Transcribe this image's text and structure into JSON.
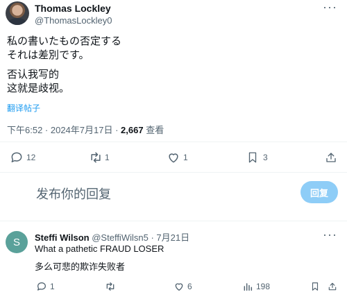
{
  "tweet": {
    "author_name": "Thomas Lockley",
    "author_handle": "@ThomasLockley0",
    "more_icon": "···",
    "text_jp_line1": "私の書いたもの否定する",
    "text_jp_line2": "それは差別です。",
    "text_cn_line1": "否认我写的",
    "text_cn_line2": "这就是歧视。",
    "translate_label": "翻译帖子",
    "timestamp": "下午6:52 · 2024年7月17日 · ",
    "views_count": "2,667",
    "views_label": " 查看",
    "actions": {
      "replies": "12",
      "reposts": "1",
      "likes": "1",
      "bookmarks": "3"
    }
  },
  "composer": {
    "placeholder": "发布你的回复",
    "button_label": "回复"
  },
  "reply": {
    "avatar_letter": "S",
    "author_name": "Steffi Wilson",
    "author_handle": "@SteffiWilsn5",
    "date": " · 7月21日",
    "text_en": "What a pathetic FRAUD LOSER",
    "text_cn": "多么可悲的欺诈失败者",
    "actions": {
      "replies": "1",
      "reposts": "",
      "likes": "6",
      "views": "198"
    }
  },
  "colors": {
    "accent": "#1d9bf0",
    "reply_button": "#8ecdf7",
    "secondary_text": "#536471",
    "avatar_s": "#5aa19a"
  }
}
